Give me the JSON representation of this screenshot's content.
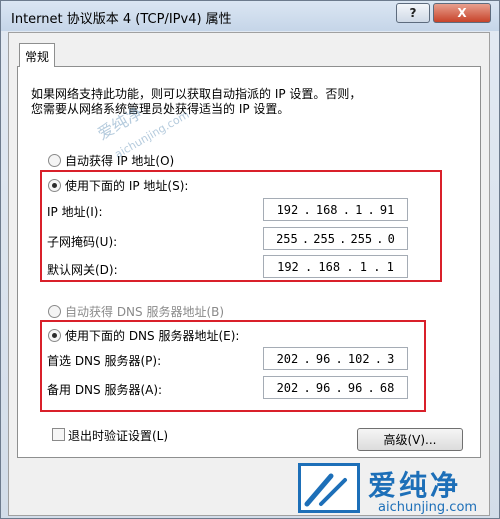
{
  "window": {
    "title": "Internet 协议版本 4 (TCP/IPv4) 属性",
    "help_label": "?",
    "close_label": "X"
  },
  "tabs": [
    {
      "label": "常规"
    }
  ],
  "description": {
    "line1": "如果网络支持此功能，则可以获取自动指派的 IP 设置。否则，",
    "line2": "您需要从网络系统管理员处获得适当的 IP 设置。"
  },
  "ip_section": {
    "auto_label": "自动获得 IP 地址(O)",
    "manual_label": "使用下面的 IP 地址(S):",
    "selected": "manual",
    "fields": [
      {
        "label": "IP 地址(I):",
        "octets": [
          "192",
          "168",
          "1",
          "91"
        ]
      },
      {
        "label": "子网掩码(U):",
        "octets": [
          "255",
          "255",
          "255",
          "0"
        ]
      },
      {
        "label": "默认网关(D):",
        "octets": [
          "192",
          "168",
          "1",
          "1"
        ]
      }
    ]
  },
  "dns_section": {
    "auto_label": "自动获得 DNS 服务器地址(B)",
    "manual_label": "使用下面的 DNS 服务器地址(E):",
    "selected": "manual",
    "fields": [
      {
        "label": "首选 DNS 服务器(P):",
        "octets": [
          "202",
          "96",
          "102",
          "3"
        ]
      },
      {
        "label": "备用 DNS 服务器(A):",
        "octets": [
          "202",
          "96",
          "96",
          "68"
        ]
      }
    ]
  },
  "footer": {
    "validate_label": "退出时验证设置(L)",
    "validate_checked": false,
    "advanced_label": "高级(V)..."
  },
  "watermark": {
    "brand_cn": "爱纯净",
    "brand_url": "aichunjing.com"
  },
  "colors": {
    "highlight_border": "#d9202a",
    "brand_blue": "#1d6fb8"
  }
}
